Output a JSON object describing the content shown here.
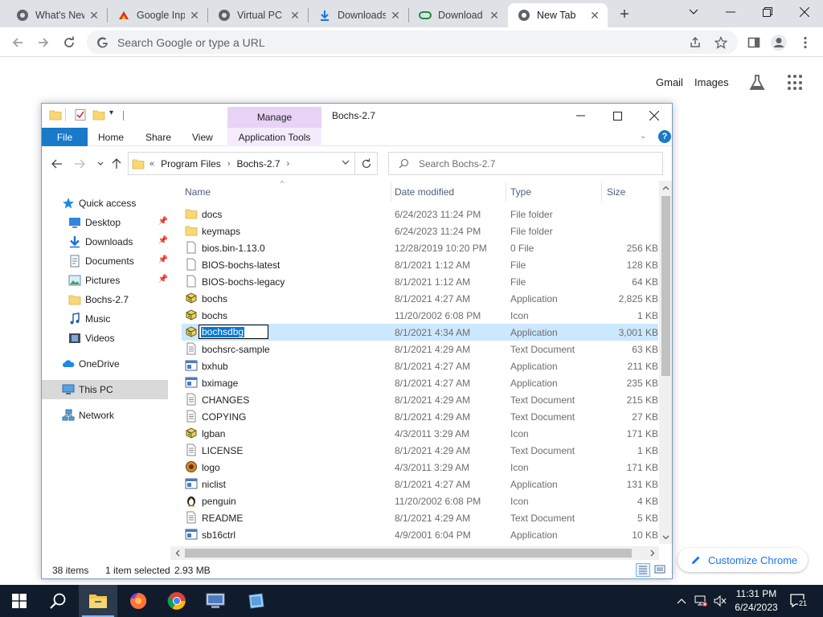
{
  "browser": {
    "tabs": [
      {
        "title": "What's New",
        "icon": "chrome-icon"
      },
      {
        "title": "Google Input",
        "icon": "google-input-icon"
      },
      {
        "title": "Virtual PC",
        "icon": "chrome-icon"
      },
      {
        "title": "Downloads",
        "icon": "download-icon"
      },
      {
        "title": "Download",
        "icon": "download-site-icon"
      },
      {
        "title": "New Tab",
        "icon": "chrome-icon",
        "active": true
      }
    ],
    "omnibox_placeholder": "Search Google or type a URL"
  },
  "ntp": {
    "gmail": "Gmail",
    "images": "Images",
    "customize": "Customize Chrome"
  },
  "explorer": {
    "title": "Bochs-2.7",
    "manage": "Manage",
    "ribbon": {
      "file": "File",
      "home": "Home",
      "share": "Share",
      "view": "View",
      "app_tools": "Application Tools"
    },
    "breadcrumb": {
      "overflow": "«",
      "items": [
        "Program Files",
        "Bochs-2.7"
      ]
    },
    "search_placeholder": "Search Bochs-2.7",
    "nav": [
      {
        "label": "Quick access",
        "icon": "star-icon"
      },
      {
        "label": "Desktop",
        "icon": "desktop-icon",
        "pinned": true
      },
      {
        "label": "Downloads",
        "icon": "download-icon",
        "pinned": true
      },
      {
        "label": "Documents",
        "icon": "documents-icon",
        "pinned": true
      },
      {
        "label": "Pictures",
        "icon": "pictures-icon",
        "pinned": true
      },
      {
        "label": "Bochs-2.7",
        "icon": "folder-icon"
      },
      {
        "label": "Music",
        "icon": "music-icon"
      },
      {
        "label": "Videos",
        "icon": "videos-icon"
      },
      {
        "label": "OneDrive",
        "icon": "cloud-icon"
      },
      {
        "label": "This PC",
        "icon": "computer-icon",
        "selected": true
      },
      {
        "label": "Network",
        "icon": "network-icon"
      }
    ],
    "columns": {
      "name": "Name",
      "date": "Date modified",
      "type": "Type",
      "size": "Size"
    },
    "files": [
      {
        "name": "docs",
        "date": "6/24/2023 11:24 PM",
        "type": "File folder",
        "size": "",
        "icon": "folder"
      },
      {
        "name": "keymaps",
        "date": "6/24/2023 11:24 PM",
        "type": "File folder",
        "size": "",
        "icon": "folder"
      },
      {
        "name": "bios.bin-1.13.0",
        "date": "12/28/2019 10:20 PM",
        "type": "0 File",
        "size": "256 KB",
        "icon": "file"
      },
      {
        "name": "BIOS-bochs-latest",
        "date": "8/1/2021 1:12 AM",
        "type": "File",
        "size": "128 KB",
        "icon": "file"
      },
      {
        "name": "BIOS-bochs-legacy",
        "date": "8/1/2021 1:12 AM",
        "type": "File",
        "size": "64 KB",
        "icon": "file"
      },
      {
        "name": "bochs",
        "date": "8/1/2021 4:27 AM",
        "type": "Application",
        "size": "2,825 KB",
        "icon": "bochs"
      },
      {
        "name": "bochs",
        "date": "11/20/2002 6:08 PM",
        "type": "Icon",
        "size": "1 KB",
        "icon": "bochs"
      },
      {
        "name": "bochsdbg",
        "date": "8/1/2021 4:34 AM",
        "type": "Application",
        "size": "3,001 KB",
        "icon": "bochs",
        "selected": true,
        "renaming": true
      },
      {
        "name": "bochsrc-sample",
        "date": "8/1/2021 4:29 AM",
        "type": "Text Document",
        "size": "63 KB",
        "icon": "text"
      },
      {
        "name": "bxhub",
        "date": "8/1/2021 4:27 AM",
        "type": "Application",
        "size": "211 KB",
        "icon": "app"
      },
      {
        "name": "bximage",
        "date": "8/1/2021 4:27 AM",
        "type": "Application",
        "size": "235 KB",
        "icon": "app"
      },
      {
        "name": "CHANGES",
        "date": "8/1/2021 4:29 AM",
        "type": "Text Document",
        "size": "215 KB",
        "icon": "text"
      },
      {
        "name": "COPYING",
        "date": "8/1/2021 4:29 AM",
        "type": "Text Document",
        "size": "27 KB",
        "icon": "text"
      },
      {
        "name": "lgban",
        "date": "4/3/2011 3:29 AM",
        "type": "Icon",
        "size": "171 KB",
        "icon": "bochs"
      },
      {
        "name": "LICENSE",
        "date": "8/1/2021 4:29 AM",
        "type": "Text Document",
        "size": "1 KB",
        "icon": "text"
      },
      {
        "name": "logo",
        "date": "4/3/2011 3:29 AM",
        "type": "Icon",
        "size": "171 KB",
        "icon": "logo"
      },
      {
        "name": "niclist",
        "date": "8/1/2021 4:27 AM",
        "type": "Application",
        "size": "131 KB",
        "icon": "app"
      },
      {
        "name": "penguin",
        "date": "11/20/2002 6:08 PM",
        "type": "Icon",
        "size": "4 KB",
        "icon": "penguin"
      },
      {
        "name": "README",
        "date": "8/1/2021 4:29 AM",
        "type": "Text Document",
        "size": "5 KB",
        "icon": "text"
      },
      {
        "name": "sb16ctrl",
        "date": "4/9/2001 6:04 PM",
        "type": "Application",
        "size": "10 KB",
        "icon": "app"
      }
    ],
    "status": {
      "count": "38 items",
      "selected": "1 item selected",
      "size": "2.93 MB"
    }
  },
  "taskbar": {
    "time": "11:31 PM",
    "date": "6/24/2023",
    "notifications": "21"
  }
}
